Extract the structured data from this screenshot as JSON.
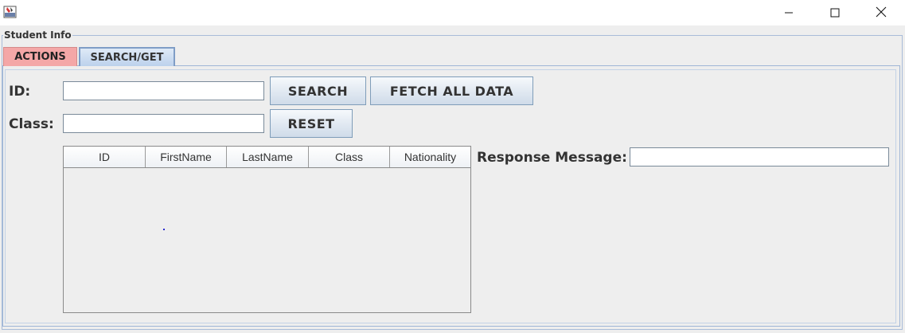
{
  "window": {
    "title": "",
    "controls": {
      "minimize_icon": "minimize-icon",
      "maximize_icon": "maximize-icon",
      "close_icon": "close-icon"
    }
  },
  "group": {
    "title": "Student Info"
  },
  "tabs": [
    {
      "label": "ACTIONS",
      "color": "#f4a7a7"
    },
    {
      "label": "SEARCH/GET",
      "selected": true
    }
  ],
  "form": {
    "id_label": "ID:",
    "id_value": "",
    "class_label": "Class:",
    "class_value": "",
    "search_button": "SEARCH",
    "fetch_all_button": "FETCH ALL DATA",
    "reset_button": "RESET"
  },
  "table": {
    "columns": [
      "ID",
      "FirstName",
      "LastName",
      "Class",
      "Nationality"
    ],
    "rows": []
  },
  "response": {
    "label": "Response Message:",
    "value": ""
  }
}
